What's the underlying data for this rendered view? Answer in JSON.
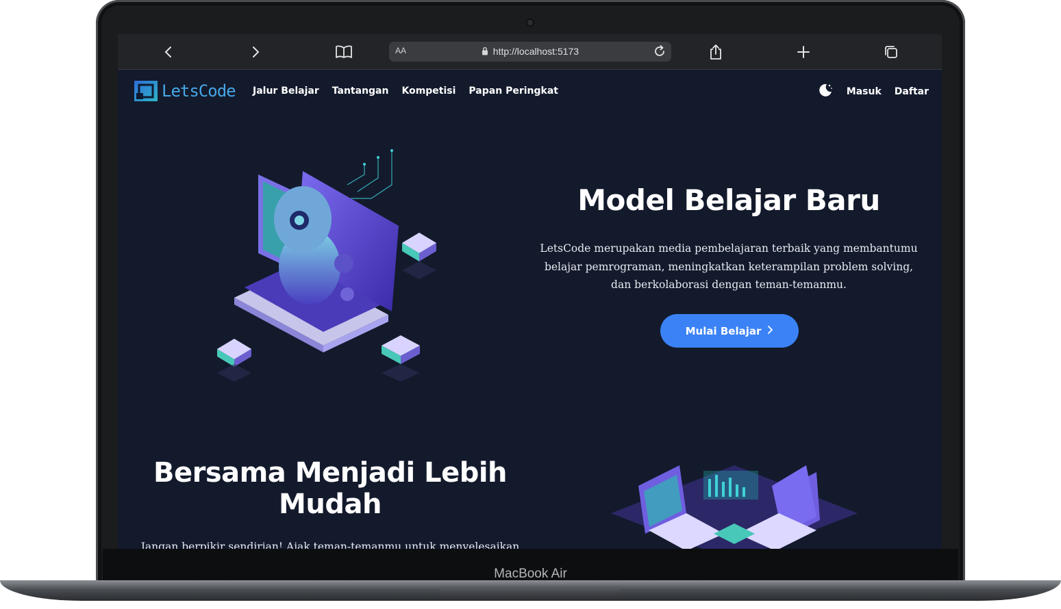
{
  "device": {
    "model_label": "MacBook Air"
  },
  "browser": {
    "text_size_label": "AA",
    "url": "http://localhost:5173",
    "icons": [
      "back-icon",
      "forward-icon",
      "bookmarks-icon",
      "lock-icon",
      "reload-icon",
      "share-icon",
      "new-tab-icon",
      "tabs-icon"
    ]
  },
  "site": {
    "logo_text": "LetsCode",
    "nav": {
      "links": [
        "Jalur Belajar",
        "Tantangan",
        "Kompetisi",
        "Papan Peringkat"
      ],
      "login": "Masuk",
      "register": "Daftar",
      "theme_icon": "moon-icon"
    },
    "hero": {
      "title": "Model Belajar Baru",
      "description": "LetsCode merupakan media pembelajaran terbaik yang membantumu belajar pemrograman, meningkatkan keterampilan problem solving, dan berkolaborasi dengan teman-temanmu.",
      "cta": "Mulai Belajar"
    },
    "section2": {
      "title": "Bersama Menjadi Lebih Mudah",
      "description": "Jangan berpikir sendirian! Ajak teman-temanmu untuk menyelesaikan"
    }
  },
  "colors": {
    "accent": "#3b82f6",
    "background": "#131a2c",
    "logo": "#46a7e6"
  }
}
